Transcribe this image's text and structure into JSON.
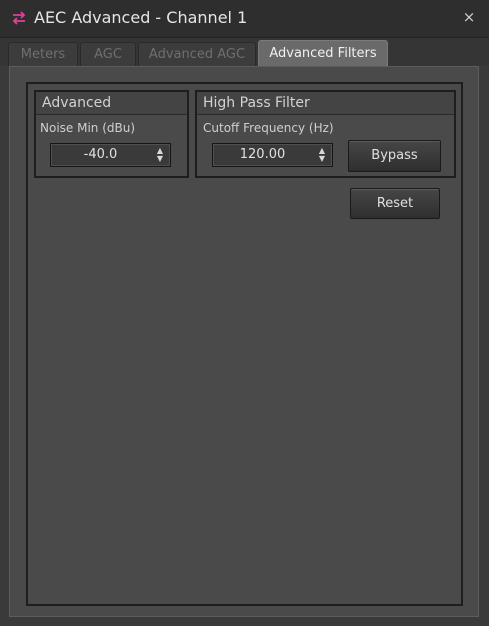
{
  "window": {
    "title": "AEC Advanced - Channel 1",
    "close_symbol": "×"
  },
  "tabs": [
    {
      "label": "Meters",
      "active": false
    },
    {
      "label": "AGC",
      "active": false
    },
    {
      "label": "Advanced AGC",
      "active": false
    },
    {
      "label": "Advanced Filters",
      "active": true
    }
  ],
  "advanced": {
    "title": "Advanced",
    "noise_min_label": "Noise Min (dBu)",
    "noise_min_value": "-40.0"
  },
  "high_pass_filter": {
    "title": "High Pass Filter",
    "cutoff_label": "Cutoff Frequency (Hz)",
    "cutoff_value": "120.00",
    "bypass_label": "Bypass"
  },
  "reset_label": "Reset",
  "icons": {
    "app": "swap-arrows-icon",
    "close": "close-icon",
    "spin_up": "chevron-up-icon",
    "spin_down": "chevron-down-icon"
  },
  "colors": {
    "app_icon": "#e0409a",
    "active_tab": "#6a6a6a",
    "background": "#4a4a4a"
  }
}
